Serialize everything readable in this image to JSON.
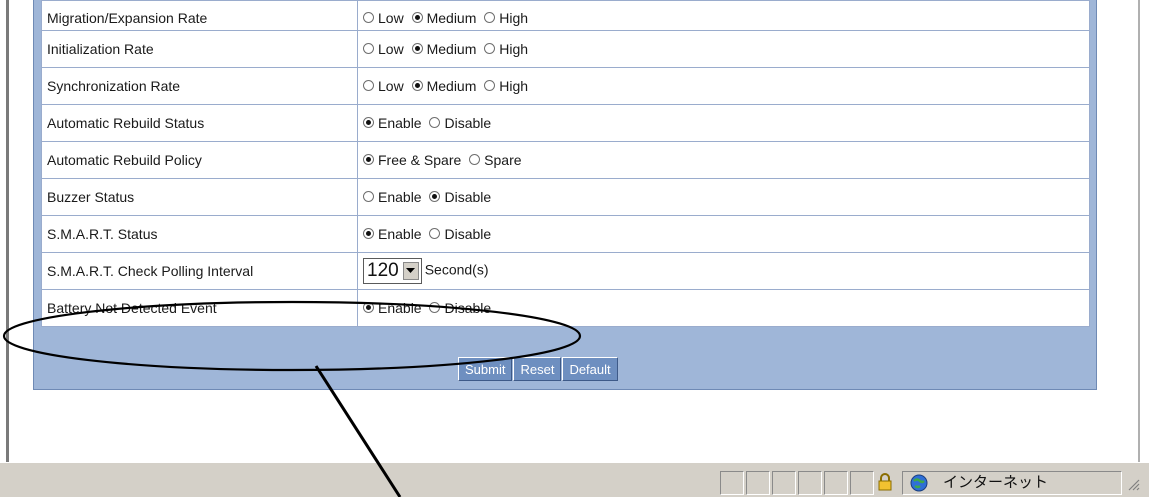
{
  "settings": {
    "rows": [
      {
        "label": "Migration/Expansion Rate",
        "options": [
          "Low",
          "Medium",
          "High"
        ],
        "selected": 1
      },
      {
        "label": "Initialization Rate",
        "options": [
          "Low",
          "Medium",
          "High"
        ],
        "selected": 1
      },
      {
        "label": "Synchronization Rate",
        "options": [
          "Low",
          "Medium",
          "High"
        ],
        "selected": 1
      },
      {
        "label": "Automatic Rebuild Status",
        "options": [
          "Enable",
          "Disable"
        ],
        "selected": 0
      },
      {
        "label": "Automatic Rebuild Policy",
        "options": [
          "Free & Spare",
          "Spare"
        ],
        "selected": 0
      },
      {
        "label": "Buzzer Status",
        "options": [
          "Enable",
          "Disable"
        ],
        "selected": 1
      },
      {
        "label": "S.M.A.R.T. Status",
        "options": [
          "Enable",
          "Disable"
        ],
        "selected": 0
      },
      {
        "label": "S.M.A.R.T. Check Polling Interval",
        "select_value": "120",
        "unit": "Second(s)"
      },
      {
        "label": "Battery Not Detected Event",
        "options": [
          "Enable",
          "Disable"
        ],
        "selected": 0
      }
    ]
  },
  "buttons": {
    "submit": "Submit",
    "reset": "Reset",
    "default": "Default"
  },
  "statusbar": {
    "zone_text": "インターネット",
    "icons": [
      "lock-icon",
      "globe-icon",
      "resize-grip-icon"
    ]
  },
  "annotation": {
    "shape": "ellipse-with-pointer-line",
    "color": "#000000"
  },
  "colors": {
    "panel": "#9fb6d8",
    "button": "#6e8fc0",
    "statusbar": "#d4d0c8"
  }
}
